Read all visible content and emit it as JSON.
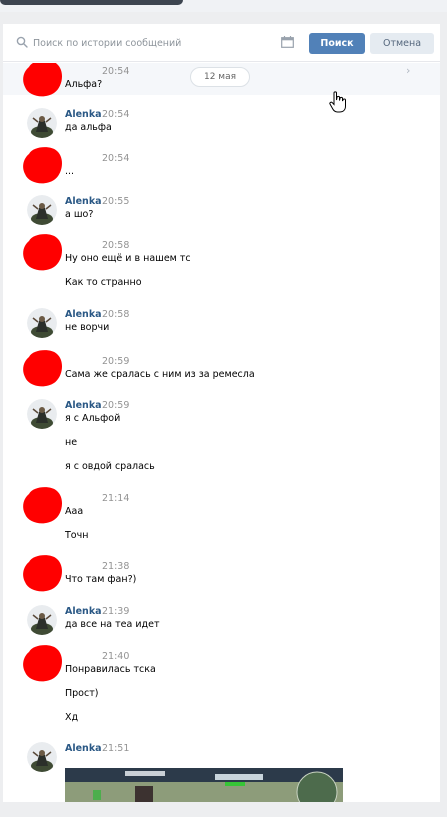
{
  "search": {
    "placeholder": "Поиск по истории сообщений",
    "search_label": "Поиск",
    "cancel_label": "Отмена"
  },
  "date_pill": "12 мая",
  "messages": [
    {
      "author": "",
      "time": "20:54",
      "lines": [
        "Альфа?"
      ],
      "redacted": true
    },
    {
      "author": "Alenka",
      "time": "20:54",
      "lines": [
        "да альфа"
      ],
      "redacted": false
    },
    {
      "author": "",
      "time": "20:54",
      "lines": [
        "..."
      ],
      "redacted": true
    },
    {
      "author": "Alenka",
      "time": "20:55",
      "lines": [
        "а шо?"
      ],
      "redacted": false
    },
    {
      "author": "",
      "time": "20:58",
      "lines": [
        "Ну оно ещё и в нашем тс",
        "Как то странно"
      ],
      "redacted": true
    },
    {
      "author": "Alenka",
      "time": "20:58",
      "lines": [
        "не ворчи"
      ],
      "redacted": false
    },
    {
      "author": "",
      "time": "20:59",
      "lines": [
        "Сама же сралась с ним из за ремесла"
      ],
      "redacted": true
    },
    {
      "author": "Alenka",
      "time": "20:59",
      "lines": [
        "я с Альфой",
        "не",
        "я с овдой сралась"
      ],
      "redacted": false
    },
    {
      "author": "",
      "time": "21:14",
      "lines": [
        "Ааа",
        "Точн"
      ],
      "redacted": true
    },
    {
      "author": "",
      "time": "21:38",
      "lines": [
        "Что там фан?)"
      ],
      "redacted": true
    },
    {
      "author": "Alenka",
      "time": "21:39",
      "lines": [
        "да все на теа идет"
      ],
      "redacted": false
    },
    {
      "author": "",
      "time": "21:40",
      "lines": [
        "Понравилась тска",
        "Прост)",
        "Хд"
      ],
      "redacted": true
    },
    {
      "author": "Alenka",
      "time": "21:51",
      "lines": [],
      "redacted": false
    }
  ],
  "colors": {
    "accent": "#5181b8",
    "author_link": "#2a5885",
    "redaction": "#ff0000"
  },
  "icons": {
    "search": "search-icon",
    "calendar": "calendar-icon",
    "cursor": "hand-pointer-icon",
    "chevron": "chevron-right-icon"
  }
}
